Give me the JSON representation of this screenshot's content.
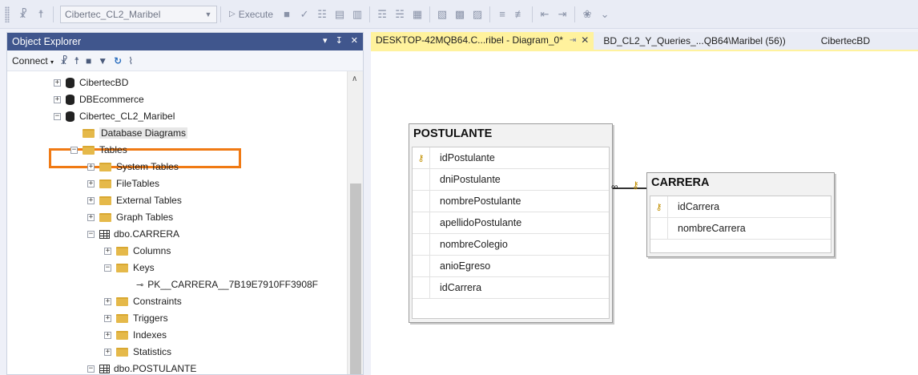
{
  "toolbar": {
    "database": "Cibertec_CL2_Maribel",
    "execute_label": "Execute"
  },
  "object_explorer": {
    "title": "Object Explorer",
    "connect_label": "Connect",
    "tree": [
      {
        "label": "CibertecBD",
        "icon": "database-icon",
        "expander": "+",
        "indent": 0
      },
      {
        "label": "DBEcommerce",
        "icon": "database-icon",
        "expander": "+",
        "indent": 0
      },
      {
        "label": "Cibertec_CL2_Maribel",
        "icon": "database-icon",
        "expander": "−",
        "indent": 0
      },
      {
        "label": "Database Diagrams",
        "icon": "folder-icon",
        "expander": "",
        "indent": 1,
        "selected": true
      },
      {
        "label": "Tables",
        "icon": "folder-icon",
        "expander": "−",
        "indent": 1
      },
      {
        "label": "System Tables",
        "icon": "folder-icon",
        "expander": "+",
        "indent": 2
      },
      {
        "label": "FileTables",
        "icon": "folder-icon",
        "expander": "+",
        "indent": 2
      },
      {
        "label": "External Tables",
        "icon": "folder-icon",
        "expander": "+",
        "indent": 2
      },
      {
        "label": "Graph Tables",
        "icon": "folder-icon",
        "expander": "+",
        "indent": 2
      },
      {
        "label": "dbo.CARRERA",
        "icon": "table-icon",
        "expander": "−",
        "indent": 2
      },
      {
        "label": "Columns",
        "icon": "folder-icon",
        "expander": "+",
        "indent": 3
      },
      {
        "label": "Keys",
        "icon": "folder-icon",
        "expander": "−",
        "indent": 3
      },
      {
        "label": "PK__CARRERA__7B19E7910FF3908F",
        "icon": "key-icon",
        "expander": "",
        "indent": 4
      },
      {
        "label": "Constraints",
        "icon": "folder-icon",
        "expander": "+",
        "indent": 3
      },
      {
        "label": "Triggers",
        "icon": "folder-icon",
        "expander": "+",
        "indent": 3
      },
      {
        "label": "Indexes",
        "icon": "folder-icon",
        "expander": "+",
        "indent": 3
      },
      {
        "label": "Statistics",
        "icon": "folder-icon",
        "expander": "+",
        "indent": 3
      },
      {
        "label": "dbo.POSTULANTE",
        "icon": "table-icon",
        "expander": "−",
        "indent": 2
      }
    ]
  },
  "tabs": [
    {
      "label": "DESKTOP-42MQB64.C...ribel - Diagram_0*",
      "active": true
    },
    {
      "label": "BD_CL2_Y_Queries_...QB64\\Maribel (56))",
      "active": false
    },
    {
      "label": "CibertecBD",
      "active": false
    }
  ],
  "diagram": {
    "postulante": {
      "title": "POSTULANTE",
      "columns": [
        "idPostulante",
        "dniPostulante",
        "nombrePostulante",
        "apellidoPostulante",
        "nombreColegio",
        "anioEgreso",
        "idCarrera"
      ],
      "primary_key": "idPostulante"
    },
    "carrera": {
      "title": "CARRERA",
      "columns": [
        "idCarrera",
        "nombreCarrera"
      ],
      "primary_key": "idCarrera"
    }
  },
  "colors": {
    "highlight": "#f07a14",
    "active_tab": "#fff29d",
    "panel_header": "#40568d"
  }
}
